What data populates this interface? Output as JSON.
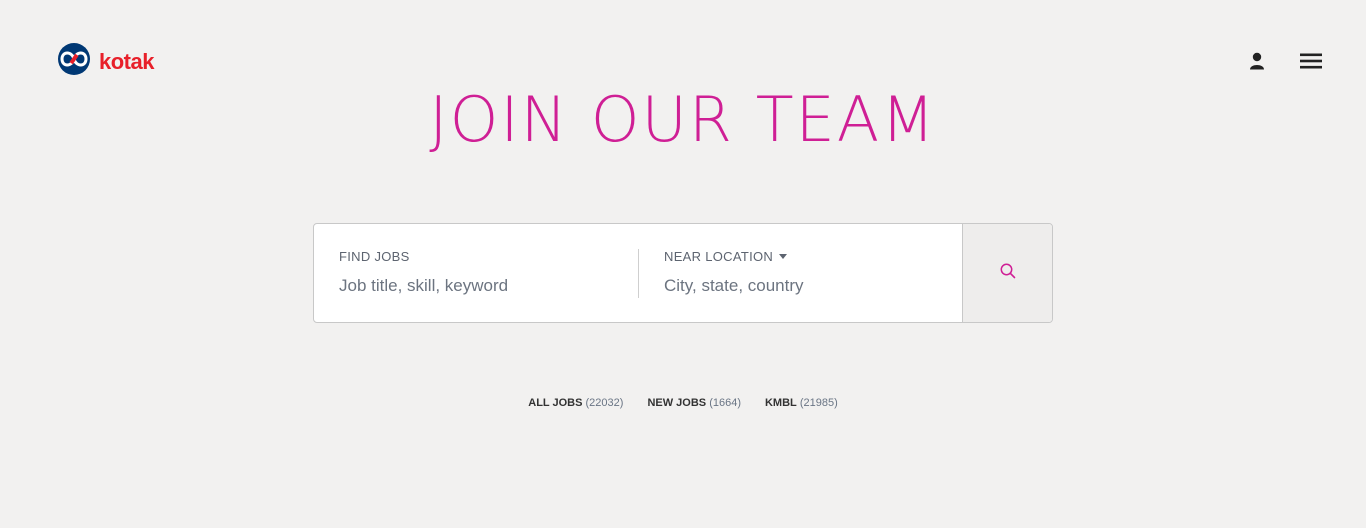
{
  "brand": {
    "logo_text": "kotak",
    "logo_icon": "kotak-infinity-icon",
    "accent_color": "#cf1f95",
    "logo_color": "#e8202a",
    "logo_blue": "#003874"
  },
  "header": {
    "account_icon": "user-icon",
    "menu_icon": "hamburger-menu-icon"
  },
  "hero": {
    "title": "JOIN OUR TEAM"
  },
  "search": {
    "find_jobs_label": "FIND JOBS",
    "find_jobs_placeholder": "Job title, skill, keyword",
    "location_label": "NEAR LOCATION",
    "location_placeholder": "City, state, country",
    "search_icon": "search-icon"
  },
  "job_links": [
    {
      "label": "ALL JOBS",
      "count": "(22032)"
    },
    {
      "label": "NEW JOBS",
      "count": "(1664)"
    },
    {
      "label": "KMBL",
      "count": "(21985)"
    }
  ]
}
